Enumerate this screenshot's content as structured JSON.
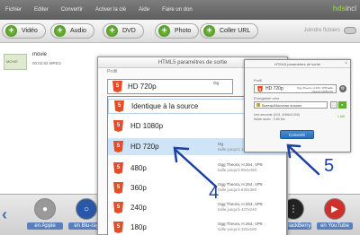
{
  "menubar": {
    "items": [
      "Fichier",
      "Editer",
      "Convertir",
      "Activer la clé",
      "Aide",
      "Faire un don"
    ],
    "logo_main": "hds",
    "logo_suffix": "incl"
  },
  "toolbar": {
    "buttons": [
      "Vidéo",
      "Audio",
      "DVD",
      "Photo",
      "Coller URL"
    ],
    "join_label": "Joindre fichiers"
  },
  "file": {
    "thumb_tag": "MOVIE",
    "name": "movie",
    "meta": "00:02:52   MPEG"
  },
  "dialog": {
    "title": "HTML5 paramètres de sortie",
    "profile_label": "Profil",
    "selected": "HD 720p",
    "selected_side": "Og",
    "options": [
      {
        "label": "Identique à la source",
        "desc": "",
        "sub": ""
      },
      {
        "label": "HD 1080p",
        "desc": "",
        "sub": ""
      },
      {
        "label": "HD 720p",
        "desc": "Og",
        "sub": "taille jusqu'à 1280x720"
      },
      {
        "label": "480p",
        "desc": "Ogg Theora, H.264, VP8",
        "sub": "taille jusqu'à 854x480"
      },
      {
        "label": "360p",
        "desc": "Ogg Theora, H.264, VP8",
        "sub": "taille jusqu'à 640x360"
      },
      {
        "label": "240p",
        "desc": "Ogg Theora, H.264, VP8",
        "sub": "taille jusqu'à 427x240"
      },
      {
        "label": "180p",
        "desc": "Ogg Theora, H.264, VP8",
        "sub": "taille jusqu'à 320x180"
      }
    ]
  },
  "mini_dialog": {
    "title": "HTML5 paramètres de sortie",
    "profile_label": "Profil",
    "selected": "HD 720p",
    "selected_side": "Ogg Theora, H.264, VP8 taille jusqu'à 1280x720",
    "dest_label": "Enregistrer vers",
    "dest_value": "Bureau\\Nouveau dossier",
    "info": "Une seconde (0:01, 4096x3 000)\nfichier audio : 0.06 Mo",
    "size": "1 MB",
    "convert": "Convertir"
  },
  "bottom": {
    "formats": [
      "en Apple",
      "en Blu-ray",
      "en BlackBerry",
      "en YouTube"
    ]
  },
  "annotations": [
    "4",
    "5"
  ]
}
